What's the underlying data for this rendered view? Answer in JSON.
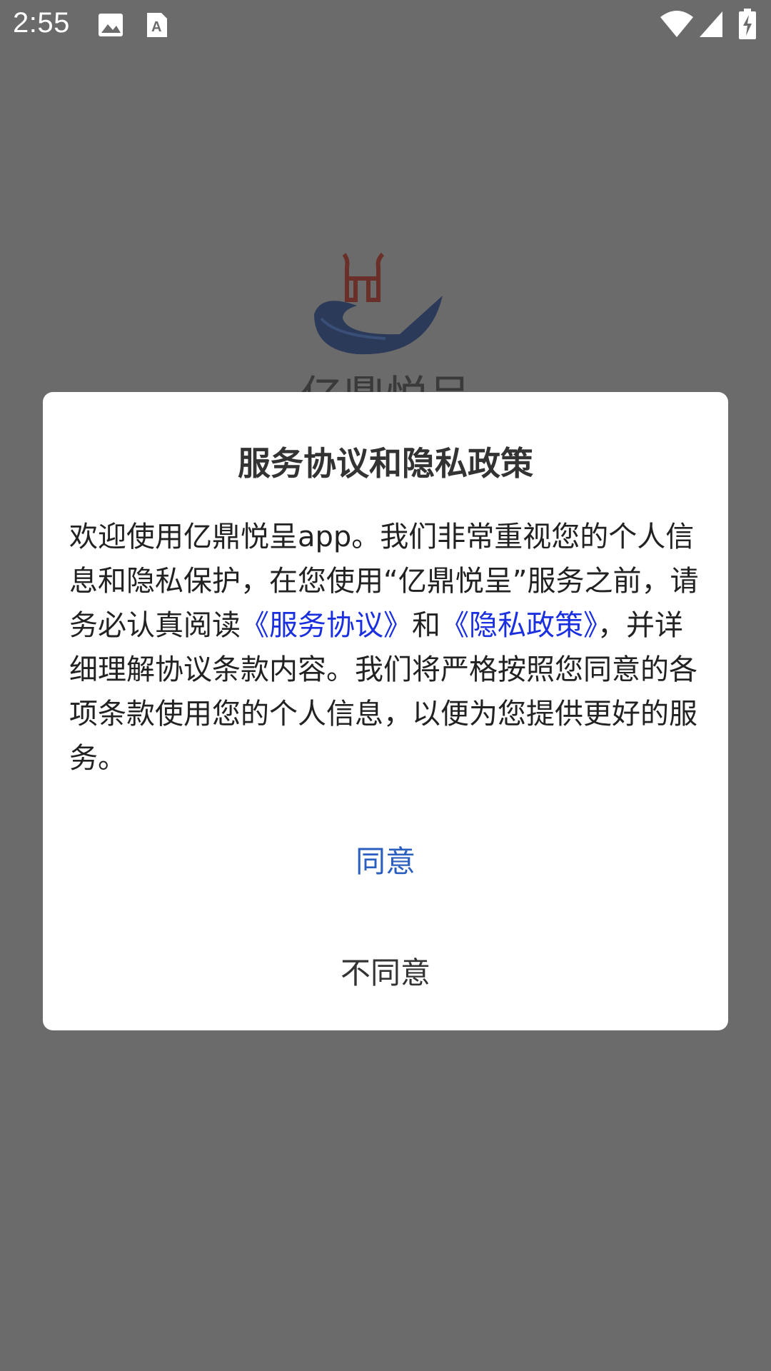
{
  "status_bar": {
    "time": "2:55",
    "icons": [
      "image-icon",
      "text-a-icon",
      "wifi-icon",
      "signal-icon",
      "battery-charging-icon"
    ]
  },
  "background": {
    "app_name": "亿鼎悦呈"
  },
  "dialog": {
    "title": "服务协议和隐私政策",
    "body_part1": "欢迎使用亿鼎悦呈app。我们非常重视您的个人信息和隐私保护，在您使用“亿鼎悦呈”服务之前，请务必认真阅读",
    "service_link": "《服务协议》",
    "body_and": "和",
    "privacy_link": "《隐私政策》",
    "body_part2": "，并详细理解协议条款内容。我们将严格按照您同意的各项条款使用您的个人信息，以便为您提供更好的服务。",
    "agree_label": "同意",
    "disagree_label": "不同意"
  },
  "colors": {
    "scrim": "#6b6b6b",
    "link": "#1a2fe0",
    "agree": "#2a5fc0"
  }
}
